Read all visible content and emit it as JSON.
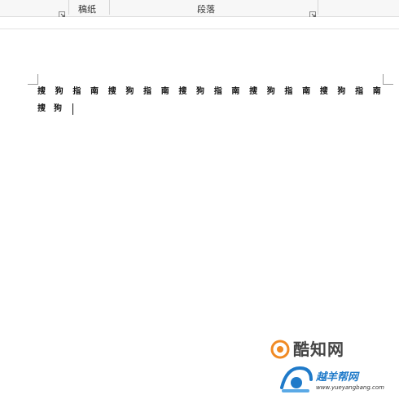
{
  "ribbon": {
    "groups": [
      {
        "label": "稿纸"
      },
      {
        "label": "段落"
      }
    ]
  },
  "document": {
    "line1": [
      "搜",
      "狗",
      "指",
      "南",
      "搜",
      "狗",
      "指",
      "南",
      "搜",
      "狗",
      "指",
      "南",
      "搜",
      "狗",
      "指",
      "南",
      "搜",
      "狗",
      "指",
      "南"
    ],
    "line2": [
      "搜",
      "狗"
    ]
  },
  "watermarks": {
    "brand1": "酷知网",
    "brand2": "越羊帮网",
    "brand2_url": "www.yueyangbang.com"
  },
  "colors": {
    "accent_orange": "#f08a24",
    "accent_blue": "#1f7ac9"
  }
}
